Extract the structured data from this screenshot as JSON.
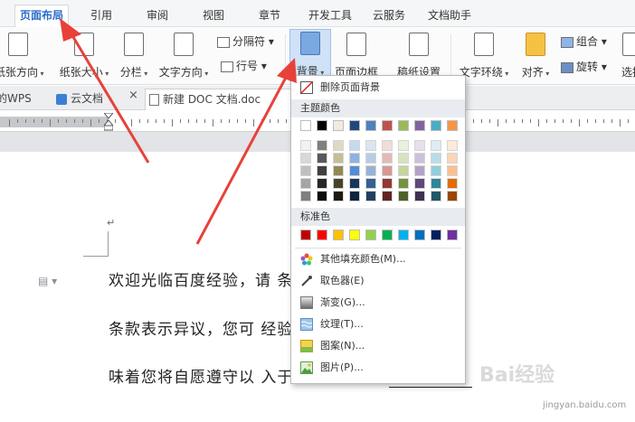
{
  "menu": {
    "tabs": [
      "页面布局",
      "引用",
      "审阅",
      "视图",
      "章节",
      "开发工具",
      "云服务",
      "文档助手"
    ]
  },
  "ribbon": {
    "paper_orientation": "纸张方向",
    "paper_size": "纸张大小",
    "columns": "分栏",
    "text_direction": "文字方向",
    "separator": "分隔符",
    "line_number": "行号",
    "background": "背景",
    "page_border": "页面边框",
    "manuscript": "稿纸设置",
    "text_wrap": "文字环绕",
    "align": "对齐",
    "group": "组合",
    "rotate": "旋转",
    "select": "选择"
  },
  "doc_tabs": {
    "tab1": "的WPS",
    "tab2": "云文档",
    "tab3": "新建 DOC 文档.doc"
  },
  "dropdown": {
    "remove_bg": "删除页面背景",
    "theme_colors": "主题颜色",
    "standard_colors": "标准色",
    "other_fill": "其他填充颜色(M)...",
    "color_picker": "取色器(E)",
    "gradient": "渐变(G)...",
    "texture": "纹理(T)...",
    "pattern": "图案(N)...",
    "picture": "图片(P)...",
    "theme_top": [
      "#ffffff",
      "#000000",
      "#eeece1",
      "#1f497d",
      "#4f81bd",
      "#c0504d",
      "#9bbb59",
      "#8064a2",
      "#4bacc6",
      "#f79646"
    ],
    "theme_shades": [
      [
        "#f2f2f2",
        "#7f7f7f",
        "#ddd9c3",
        "#c6d9f0",
        "#dbe5f1",
        "#f2dcdb",
        "#ebf1dd",
        "#e5e0ec",
        "#dbeef3",
        "#fdeada"
      ],
      [
        "#d8d8d8",
        "#595959",
        "#c4bd97",
        "#8db3e2",
        "#b8cce4",
        "#e5b9b7",
        "#d7e3bc",
        "#ccc1d9",
        "#b7dde8",
        "#fbd5b5"
      ],
      [
        "#bfbfbf",
        "#3f3f3f",
        "#938953",
        "#548dd4",
        "#95b3d7",
        "#d99694",
        "#c3d69b",
        "#b2a2c7",
        "#92cddc",
        "#fac08f"
      ],
      [
        "#a5a5a5",
        "#262626",
        "#494429",
        "#17365d",
        "#366092",
        "#953734",
        "#76923c",
        "#5f497a",
        "#31859b",
        "#e36c09"
      ],
      [
        "#7f7f7f",
        "#0c0c0c",
        "#1d1b10",
        "#0f243e",
        "#244061",
        "#632423",
        "#4f6128",
        "#3f3151",
        "#205867",
        "#974806"
      ]
    ],
    "standard": [
      "#c00000",
      "#ff0000",
      "#ffc000",
      "#ffff00",
      "#92d050",
      "#00b050",
      "#00b0f0",
      "#0070c0",
      "#002060",
      "#7030a0"
    ]
  },
  "document": {
    "line1": "欢迎光临百度经验，请                  条款。如果您对本协议",
    "line2": "条款表示异议，您可            经验。您进入百度经验",
    "line3": "味着您将自愿遵守以                  入于百度经验的统一",
    "para_mark": "↵"
  },
  "watermark": "jingyan.baidu.com",
  "colors": {
    "accent": "#2a6cc9",
    "arrow": "#e8413a"
  }
}
